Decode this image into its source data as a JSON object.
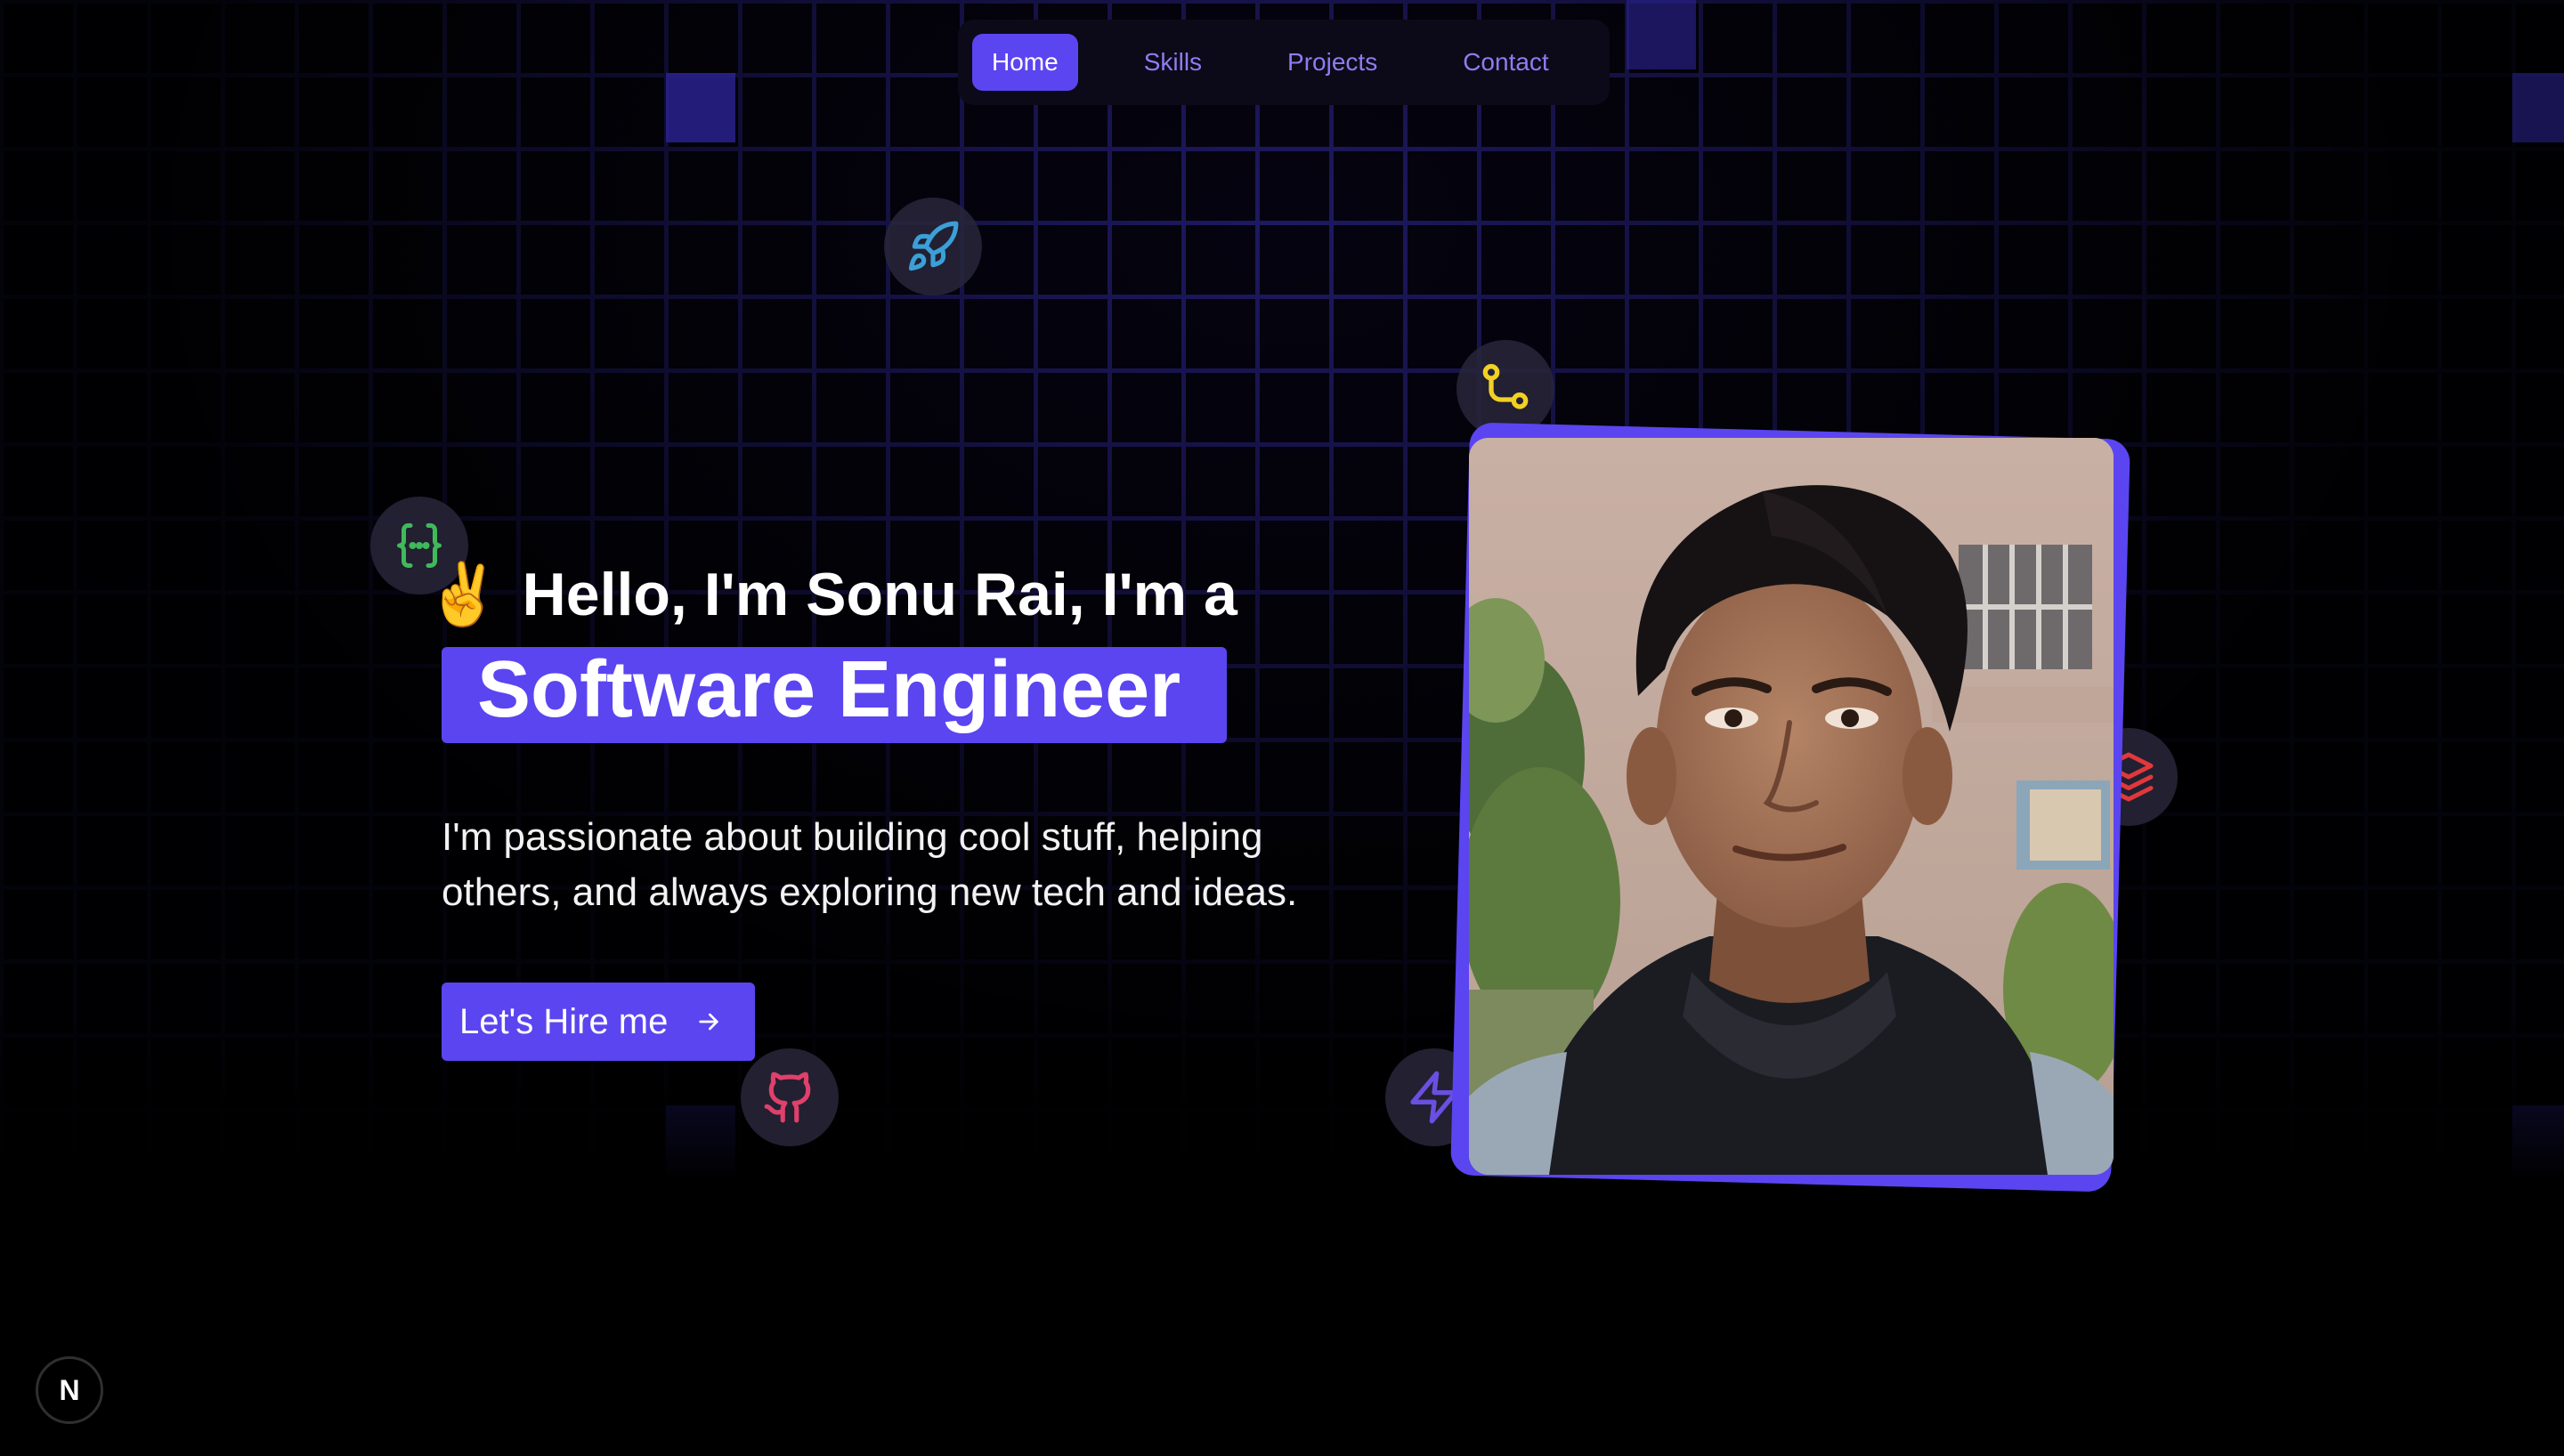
{
  "nav": {
    "items": [
      {
        "label": "Home",
        "active": true
      },
      {
        "label": "Skills",
        "active": false
      },
      {
        "label": "Projects",
        "active": false
      },
      {
        "label": "Contact",
        "active": false
      }
    ]
  },
  "hero": {
    "greeting_emoji": "✌",
    "greeting": "Hello, I'm Sonu Rai, I'm a",
    "role": "Software Engineer",
    "description_line1": "I'm passionate about building cool stuff, helping",
    "description_line2": "others, and always exploring new tech and ideas.",
    "cta_label": "Let's Hire me"
  },
  "floating_icons": [
    {
      "name": "rocket-icon",
      "color": "#3b9fd8"
    },
    {
      "name": "git-branch-icon",
      "color": "#f2d024"
    },
    {
      "name": "code-braces-icon",
      "color": "#3fb95a"
    },
    {
      "name": "layers-icon",
      "color": "#e0383b"
    },
    {
      "name": "github-icon",
      "color": "#e0406b"
    },
    {
      "name": "lightning-icon",
      "color": "#6a4fe0"
    }
  ],
  "colors": {
    "accent": "#5b45f0",
    "nav_text": "#8f7cf0",
    "grid": "#1f1a66",
    "background": "#000000"
  },
  "badge": {
    "label": "N"
  }
}
